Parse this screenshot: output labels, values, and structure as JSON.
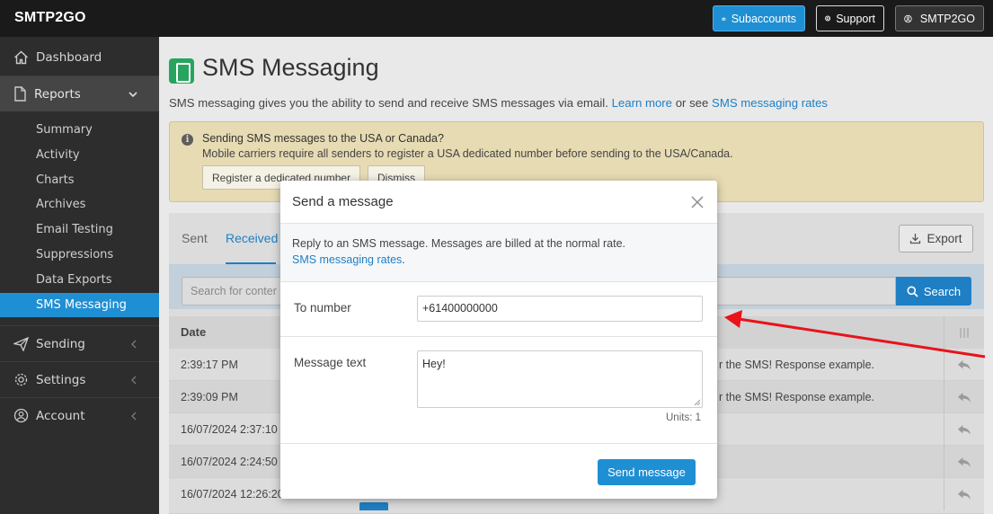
{
  "topbar": {
    "logo": "SMTP2GO",
    "subaccounts_label": "Subaccounts",
    "support_label": "Support",
    "account_label": "SMTP2GO"
  },
  "sidebar": {
    "dashboard": "Dashboard",
    "reports": "Reports",
    "reports_sub": [
      "Summary",
      "Activity",
      "Charts",
      "Archives",
      "Email Testing",
      "Suppressions",
      "Data Exports",
      "SMS Messaging"
    ],
    "sending": "Sending",
    "settings": "Settings",
    "account": "Account"
  },
  "page": {
    "title": "SMS Messaging",
    "intro_text": "SMS messaging gives you the ability to send and receive SMS messages via email.",
    "learn_more": "Learn more",
    "or_see": "or see",
    "rates_link": "SMS messaging rates"
  },
  "alert": {
    "title": "Sending SMS messages to the USA or Canada?",
    "text": "Mobile carriers require all senders to register a USA dedicated number before sending to the USA/Canada.",
    "register_label": "Register a dedicated number",
    "dismiss_label": "Dismiss"
  },
  "panel": {
    "tab_sent": "Sent",
    "tab_received": "Received",
    "export_label": "Export",
    "search_placeholder": "Search for conter",
    "search_label": "Search",
    "col_date": "Date",
    "rows": [
      {
        "date": "",
        "time": "2:39:17 PM",
        "message": "r the SMS! Response example."
      },
      {
        "date": "",
        "time": "2:39:09 PM",
        "message": "r the SMS! Response example."
      },
      {
        "date": "16/07/2024",
        "time": "2:37:10",
        "message": ""
      },
      {
        "date": "16/07/2024",
        "time": "2:24:50",
        "message": ""
      },
      {
        "date": "16/07/2024",
        "time": "12:26:20",
        "message": ""
      }
    ]
  },
  "modal": {
    "title": "Send a message",
    "info_line1": "Reply to an SMS message. Messages are billed at the normal rate.",
    "info_link": "SMS messaging rates",
    "to_label": "To number",
    "to_value": "+61400000000",
    "message_label": "Message text",
    "message_value": "Hey!",
    "units": "Units: 1",
    "send_label": "Send message"
  },
  "colors": {
    "accent": "#1f8fd3",
    "annotation_arrow": "#e8131b"
  }
}
